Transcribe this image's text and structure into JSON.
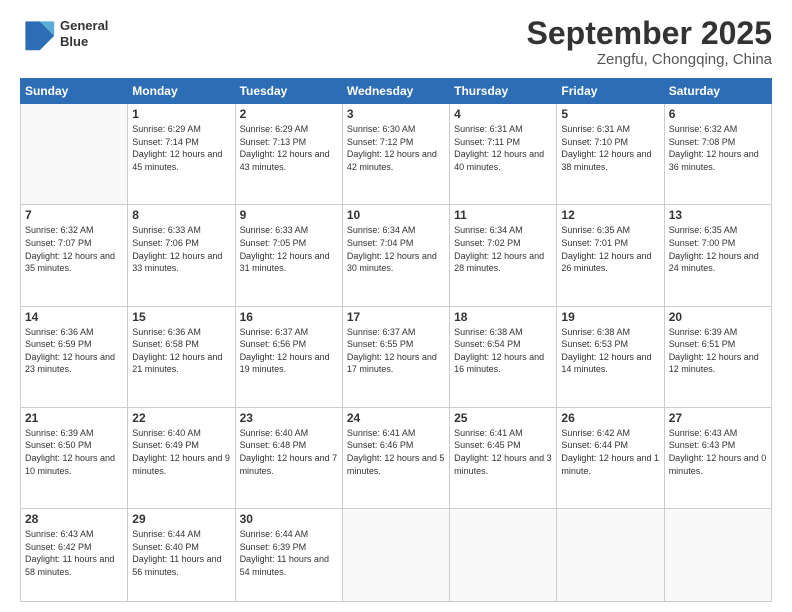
{
  "header": {
    "logo_line1": "General",
    "logo_line2": "Blue",
    "month": "September 2025",
    "location": "Zengfu, Chongqing, China"
  },
  "days_of_week": [
    "Sunday",
    "Monday",
    "Tuesday",
    "Wednesday",
    "Thursday",
    "Friday",
    "Saturday"
  ],
  "weeks": [
    [
      {
        "day": "",
        "info": ""
      },
      {
        "day": "1",
        "info": "Sunrise: 6:29 AM\nSunset: 7:14 PM\nDaylight: 12 hours and 45 minutes."
      },
      {
        "day": "2",
        "info": "Sunrise: 6:29 AM\nSunset: 7:13 PM\nDaylight: 12 hours and 43 minutes."
      },
      {
        "day": "3",
        "info": "Sunrise: 6:30 AM\nSunset: 7:12 PM\nDaylight: 12 hours and 42 minutes."
      },
      {
        "day": "4",
        "info": "Sunrise: 6:31 AM\nSunset: 7:11 PM\nDaylight: 12 hours and 40 minutes."
      },
      {
        "day": "5",
        "info": "Sunrise: 6:31 AM\nSunset: 7:10 PM\nDaylight: 12 hours and 38 minutes."
      },
      {
        "day": "6",
        "info": "Sunrise: 6:32 AM\nSunset: 7:08 PM\nDaylight: 12 hours and 36 minutes."
      }
    ],
    [
      {
        "day": "7",
        "info": "Sunrise: 6:32 AM\nSunset: 7:07 PM\nDaylight: 12 hours and 35 minutes."
      },
      {
        "day": "8",
        "info": "Sunrise: 6:33 AM\nSunset: 7:06 PM\nDaylight: 12 hours and 33 minutes."
      },
      {
        "day": "9",
        "info": "Sunrise: 6:33 AM\nSunset: 7:05 PM\nDaylight: 12 hours and 31 minutes."
      },
      {
        "day": "10",
        "info": "Sunrise: 6:34 AM\nSunset: 7:04 PM\nDaylight: 12 hours and 30 minutes."
      },
      {
        "day": "11",
        "info": "Sunrise: 6:34 AM\nSunset: 7:02 PM\nDaylight: 12 hours and 28 minutes."
      },
      {
        "day": "12",
        "info": "Sunrise: 6:35 AM\nSunset: 7:01 PM\nDaylight: 12 hours and 26 minutes."
      },
      {
        "day": "13",
        "info": "Sunrise: 6:35 AM\nSunset: 7:00 PM\nDaylight: 12 hours and 24 minutes."
      }
    ],
    [
      {
        "day": "14",
        "info": "Sunrise: 6:36 AM\nSunset: 6:59 PM\nDaylight: 12 hours and 23 minutes."
      },
      {
        "day": "15",
        "info": "Sunrise: 6:36 AM\nSunset: 6:58 PM\nDaylight: 12 hours and 21 minutes."
      },
      {
        "day": "16",
        "info": "Sunrise: 6:37 AM\nSunset: 6:56 PM\nDaylight: 12 hours and 19 minutes."
      },
      {
        "day": "17",
        "info": "Sunrise: 6:37 AM\nSunset: 6:55 PM\nDaylight: 12 hours and 17 minutes."
      },
      {
        "day": "18",
        "info": "Sunrise: 6:38 AM\nSunset: 6:54 PM\nDaylight: 12 hours and 16 minutes."
      },
      {
        "day": "19",
        "info": "Sunrise: 6:38 AM\nSunset: 6:53 PM\nDaylight: 12 hours and 14 minutes."
      },
      {
        "day": "20",
        "info": "Sunrise: 6:39 AM\nSunset: 6:51 PM\nDaylight: 12 hours and 12 minutes."
      }
    ],
    [
      {
        "day": "21",
        "info": "Sunrise: 6:39 AM\nSunset: 6:50 PM\nDaylight: 12 hours and 10 minutes."
      },
      {
        "day": "22",
        "info": "Sunrise: 6:40 AM\nSunset: 6:49 PM\nDaylight: 12 hours and 9 minutes."
      },
      {
        "day": "23",
        "info": "Sunrise: 6:40 AM\nSunset: 6:48 PM\nDaylight: 12 hours and 7 minutes."
      },
      {
        "day": "24",
        "info": "Sunrise: 6:41 AM\nSunset: 6:46 PM\nDaylight: 12 hours and 5 minutes."
      },
      {
        "day": "25",
        "info": "Sunrise: 6:41 AM\nSunset: 6:45 PM\nDaylight: 12 hours and 3 minutes."
      },
      {
        "day": "26",
        "info": "Sunrise: 6:42 AM\nSunset: 6:44 PM\nDaylight: 12 hours and 1 minute."
      },
      {
        "day": "27",
        "info": "Sunrise: 6:43 AM\nSunset: 6:43 PM\nDaylight: 12 hours and 0 minutes."
      }
    ],
    [
      {
        "day": "28",
        "info": "Sunrise: 6:43 AM\nSunset: 6:42 PM\nDaylight: 11 hours and 58 minutes."
      },
      {
        "day": "29",
        "info": "Sunrise: 6:44 AM\nSunset: 6:40 PM\nDaylight: 11 hours and 56 minutes."
      },
      {
        "day": "30",
        "info": "Sunrise: 6:44 AM\nSunset: 6:39 PM\nDaylight: 11 hours and 54 minutes."
      },
      {
        "day": "",
        "info": ""
      },
      {
        "day": "",
        "info": ""
      },
      {
        "day": "",
        "info": ""
      },
      {
        "day": "",
        "info": ""
      }
    ]
  ]
}
